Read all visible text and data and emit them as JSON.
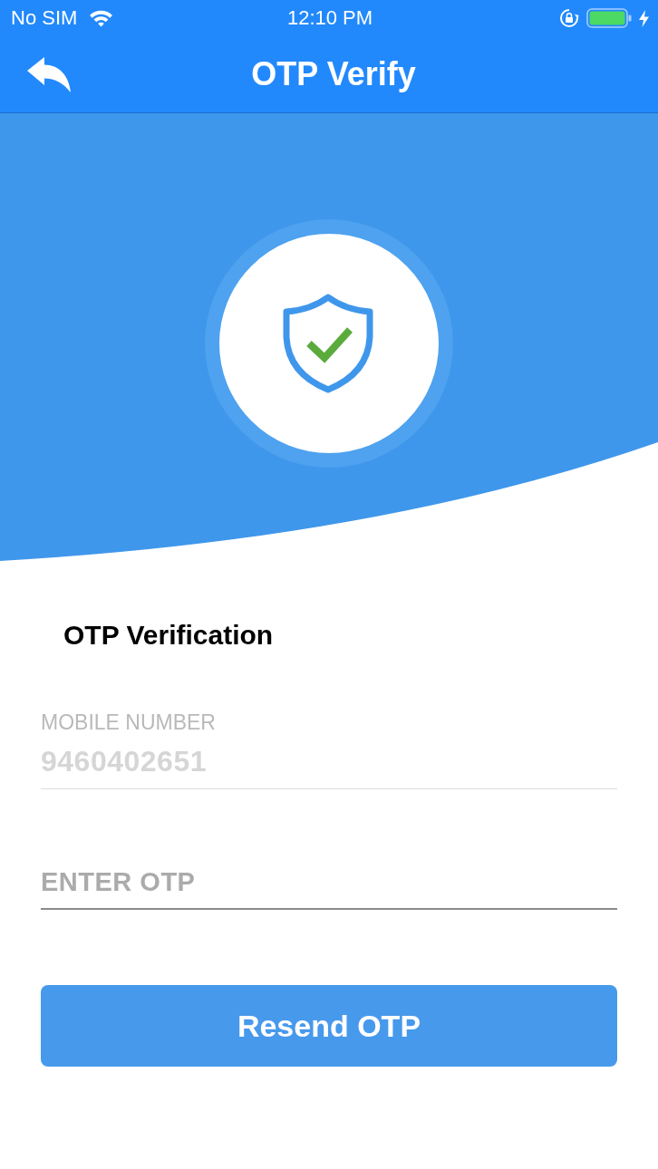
{
  "status_bar": {
    "carrier": "No SIM",
    "time": "12:10 PM"
  },
  "nav_bar": {
    "title": "OTP Verify"
  },
  "form": {
    "heading": "OTP Verification",
    "fields": [
      {
        "kind": "labeled",
        "label": "MOBILE NUMBER",
        "value": "9460402651",
        "disabled": true
      },
      {
        "kind": "plain",
        "placeholder": "ENTER OTP",
        "disabled": false
      }
    ]
  },
  "button": {
    "label": "Resend OTP"
  }
}
